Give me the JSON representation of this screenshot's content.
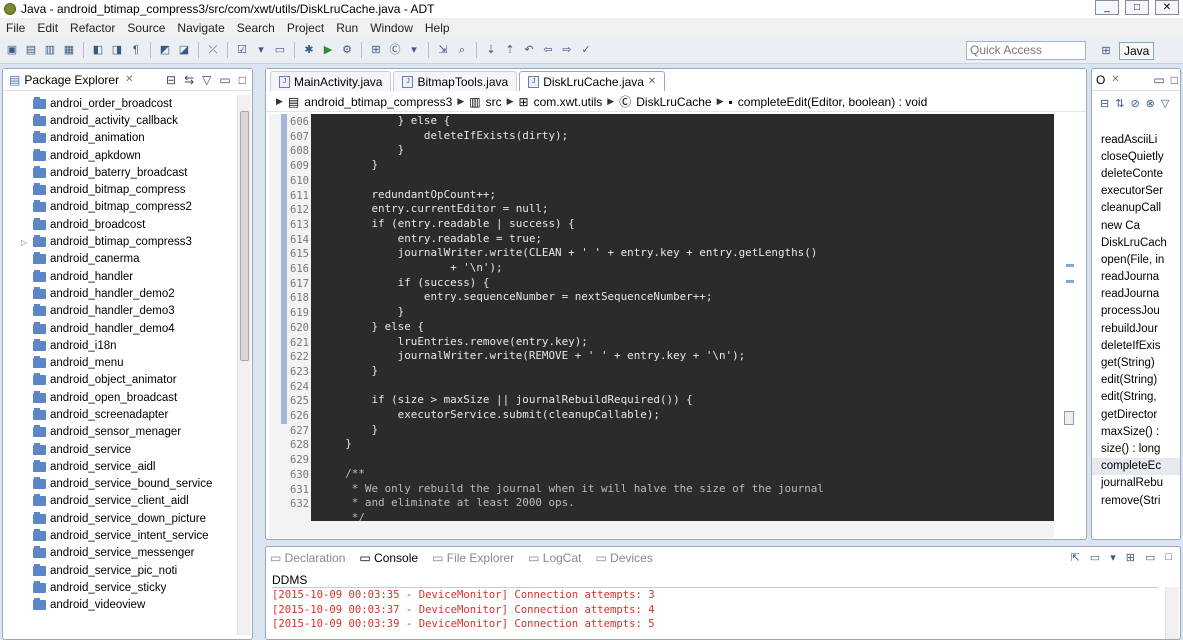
{
  "window": {
    "title": "Java - android_btimap_compress3/src/com/xwt/utils/DiskLruCache.java - ADT"
  },
  "menu": [
    "File",
    "Edit",
    "Refactor",
    "Source",
    "Navigate",
    "Search",
    "Project",
    "Run",
    "Window",
    "Help"
  ],
  "quick_access": {
    "placeholder": "Quick Access"
  },
  "perspective": {
    "label": "Java"
  },
  "package_explorer": {
    "title": "Package Explorer",
    "items": [
      "androi_order_broadcost",
      "android_activity_callback",
      "android_animation",
      "android_apkdown",
      "android_baterry_broadcast",
      "android_bitmap_compress",
      "android_bitmap_compress2",
      "android_broadcost",
      "android_btimap_compress3",
      "android_canerma",
      "android_handler",
      "android_handler_demo2",
      "android_handler_demo3",
      "android_handler_demo4",
      "android_i18n",
      "android_menu",
      "android_object_animator",
      "android_open_broadcast",
      "android_screenadapter",
      "android_sensor_menager",
      "android_service",
      "android_service_aidl",
      "android_service_bound_service",
      "android_service_client_aidl",
      "android_service_down_picture",
      "android_service_intent_service",
      "android_service_messenger",
      "android_service_pic_noti",
      "android_service_sticky",
      "android_videoview"
    ],
    "expanded_index": 8
  },
  "editor": {
    "tabs": [
      {
        "label": "MainActivity.java"
      },
      {
        "label": "BitmapTools.java"
      },
      {
        "label": "DiskLruCache.java",
        "active": true
      }
    ],
    "breadcrumb": [
      "android_btimap_compress3",
      "src",
      "com.xwt.utils",
      "DiskLruCache",
      "completeEdit(Editor, boolean) : void"
    ],
    "line_numbers": [
      "606",
      "607",
      "608",
      "609",
      "610",
      "611",
      "612",
      "613",
      "614",
      "615",
      "616",
      "617",
      "618",
      "619",
      "620",
      "621",
      "622",
      "623",
      "624",
      "625",
      "626",
      "627",
      "628",
      "629",
      "630",
      "631",
      "632"
    ],
    "code": [
      "            } else {",
      "                deleteIfExists(dirty);",
      "            }",
      "        }",
      "",
      "        redundantOpCount++;",
      "        entry.currentEditor = null;",
      "        if (entry.readable | success) {",
      "            entry.readable = true;",
      "            journalWriter.write(CLEAN + ' ' + entry.key + entry.getLengths()",
      "                    + '\\n');",
      "            if (success) {",
      "                entry.sequenceNumber = nextSequenceNumber++;",
      "            }",
      "        } else {",
      "            lruEntries.remove(entry.key);",
      "            journalWriter.write(REMOVE + ' ' + entry.key + '\\n');",
      "        }",
      "",
      "        if (size > maxSize || journalRebuildRequired()) {",
      "            executorService.submit(cleanupCallable);",
      "        }",
      "    }",
      "",
      "    /**",
      "     * We only rebuild the journal when it will halve the size of the journal",
      "     * and eliminate at least 2000 ops.",
      "     */"
    ]
  },
  "outline": {
    "tab": "O",
    "items": [
      "readAsciiLi",
      "closeQuietly",
      "deleteConte",
      "executorSer",
      "cleanupCall",
      "new Ca",
      "DiskLruCach",
      "open(File, in",
      "readJourna",
      "readJourna",
      "processJou",
      "rebuildJour",
      "deleteIfExis",
      "get(String)",
      "edit(String)",
      "edit(String,",
      "getDirector",
      "maxSize() :",
      "size() : long",
      "completeEc",
      "journalRebu",
      "remove(Stri"
    ]
  },
  "console": {
    "tabs": [
      "Declaration",
      "Console",
      "File Explorer",
      "LogCat",
      "Devices"
    ],
    "active": "Console",
    "header": "DDMS",
    "lines": [
      "[2015-10-09 00:03:35 - DeviceMonitor] Connection attempts: 3",
      "[2015-10-09 00:03:37 - DeviceMonitor] Connection attempts: 4",
      "[2015-10-09 00:03:39 - DeviceMonitor] Connection attempts: 5"
    ]
  }
}
